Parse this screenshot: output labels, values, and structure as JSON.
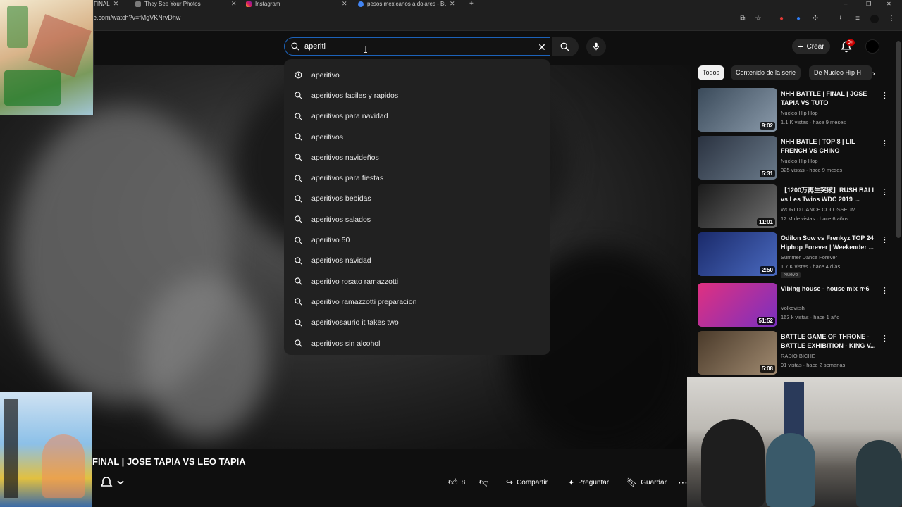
{
  "browser": {
    "tabs": [
      {
        "label": "FINAL"
      },
      {
        "label": "They See Your Photos"
      },
      {
        "label": "Instagram"
      },
      {
        "label": "pesos mexicanos a dolares - Bu"
      }
    ],
    "url": "e.com/watch?v=fMgVKNrvDhw"
  },
  "header": {
    "search_value": "aperiti",
    "create_label": "Crear",
    "notif_count": "9+"
  },
  "suggestions": [
    {
      "text": "aperitivo",
      "icon": "history-icon"
    },
    {
      "text": "aperitivos faciles y rapidos",
      "icon": "search-icon"
    },
    {
      "text": "aperitivos para navidad",
      "icon": "search-icon"
    },
    {
      "text": "aperitivos",
      "icon": "search-icon"
    },
    {
      "text": "aperitivos navideños",
      "icon": "search-icon"
    },
    {
      "text": "aperitivos para fiestas",
      "icon": "search-icon"
    },
    {
      "text": "aperitivos bebidas",
      "icon": "search-icon"
    },
    {
      "text": "aperitivos salados",
      "icon": "search-icon"
    },
    {
      "text": "aperitivo 50",
      "icon": "search-icon"
    },
    {
      "text": "aperitivos navidad",
      "icon": "search-icon"
    },
    {
      "text": "aperitivo rosato ramazzotti",
      "icon": "search-icon"
    },
    {
      "text": "aperitivo ramazzotti preparacion",
      "icon": "search-icon"
    },
    {
      "text": "aperitivosaurio it takes two",
      "icon": "search-icon"
    },
    {
      "text": "aperitivos sin alcohol",
      "icon": "search-icon"
    }
  ],
  "video": {
    "title": "FINAL | JOSE TAPIA VS LEO TAPIA",
    "likes": "8",
    "share_label": "Compartir",
    "ask_label": "Preguntar",
    "save_label": "Guardar"
  },
  "chips": [
    "Todos",
    "Contenido de la serie",
    "De Nucleo Hip H"
  ],
  "recommendations": [
    {
      "title": "NHH BATTLE | FINAL | JOSE TAPIA VS TUTO",
      "channel": "Nucleo Hip Hop",
      "meta": "1.1 K vistas · hace 9 meses",
      "duration": "9:02",
      "colors": [
        "#3a4a5a",
        "#8a9aaa"
      ]
    },
    {
      "title": "NHH BATLE | TOP 8 | LIL FRENCH VS CHINO",
      "channel": "Nucleo Hip Hop",
      "meta": "325 vistas · hace 9 meses",
      "duration": "5:31",
      "colors": [
        "#2a3240",
        "#6a7a8a"
      ]
    },
    {
      "title": "【1200万再生突破】RUSH BALL vs Les Twins WDC 2019 ...",
      "channel": "WORLD DANCE COLOSSEUM",
      "meta": "12 M de vistas · hace 6 años",
      "duration": "11:01",
      "colors": [
        "#1a1a1a",
        "#707070"
      ]
    },
    {
      "title": "Odilon Sow vs Frenkyz TOP 24 Hiphop Forever | Weekender ...",
      "channel": "Summer Dance Forever",
      "meta": "1.7 K vistas · hace 4 días",
      "duration": "2:50",
      "badge": "Nuevo",
      "colors": [
        "#1a2a6a",
        "#4a6ac0"
      ]
    },
    {
      "title": "Vibing house - house mix n°6",
      "channel": "Volkovitsh",
      "meta": "163 k vistas · hace 1 año",
      "duration": "51:52",
      "colors": [
        "#e03080",
        "#7a30c0"
      ]
    },
    {
      "title": "BATTLE GAME OF THRONE - BATTLE EXHIBITION - KING V...",
      "channel": "RADIO BICHE",
      "meta": "91 vistas · hace 2 semanas",
      "duration": "5:08",
      "colors": [
        "#4a3a2a",
        "#a08a70"
      ]
    }
  ]
}
